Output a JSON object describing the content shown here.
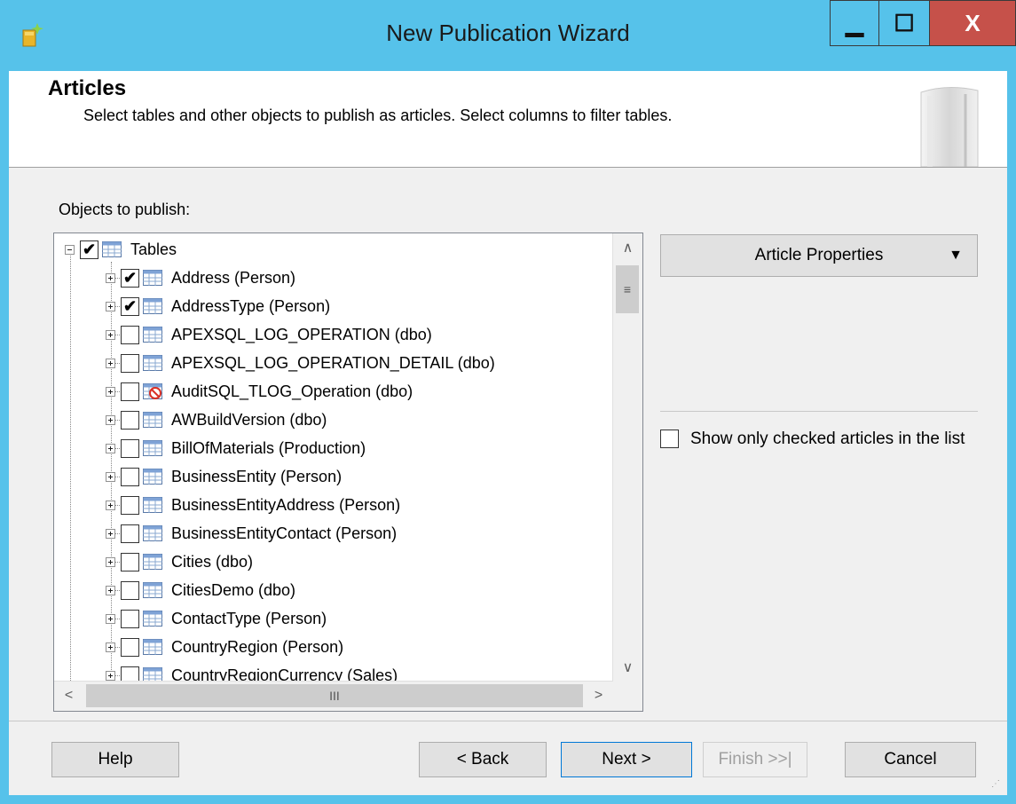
{
  "window": {
    "title": "New Publication Wizard",
    "controls": {
      "minimize": "▁",
      "maximize": "☐",
      "close": "X"
    }
  },
  "header": {
    "title": "Articles",
    "description": "Select tables and other objects to publish as articles. Select columns to filter tables."
  },
  "objects_label": "Objects to publish:",
  "tree": {
    "root": {
      "label": "Tables",
      "checked": true
    },
    "items": [
      {
        "label": "Address (Person)",
        "checked": true,
        "icon": "table-icon"
      },
      {
        "label": "AddressType (Person)",
        "checked": true,
        "icon": "table-icon"
      },
      {
        "label": "APEXSQL_LOG_OPERATION (dbo)",
        "checked": false,
        "icon": "table-icon"
      },
      {
        "label": "APEXSQL_LOG_OPERATION_DETAIL (dbo)",
        "checked": false,
        "icon": "table-icon"
      },
      {
        "label": "AuditSQL_TLOG_Operation (dbo)",
        "checked": false,
        "icon": "table-blocked-icon"
      },
      {
        "label": "AWBuildVersion (dbo)",
        "checked": false,
        "icon": "table-icon"
      },
      {
        "label": "BillOfMaterials (Production)",
        "checked": false,
        "icon": "table-icon"
      },
      {
        "label": "BusinessEntity (Person)",
        "checked": false,
        "icon": "table-icon"
      },
      {
        "label": "BusinessEntityAddress (Person)",
        "checked": false,
        "icon": "table-icon"
      },
      {
        "label": "BusinessEntityContact (Person)",
        "checked": false,
        "icon": "table-icon"
      },
      {
        "label": "Cities (dbo)",
        "checked": false,
        "icon": "table-icon"
      },
      {
        "label": "CitiesDemo (dbo)",
        "checked": false,
        "icon": "table-icon"
      },
      {
        "label": "ContactType (Person)",
        "checked": false,
        "icon": "table-icon"
      },
      {
        "label": "CountryRegion (Person)",
        "checked": false,
        "icon": "table-icon"
      },
      {
        "label": "CountryRegionCurrency (Sales)",
        "checked": false,
        "icon": "table-icon"
      }
    ]
  },
  "article_properties": {
    "label": "Article Properties",
    "arrow": "▼"
  },
  "show_only_checked": {
    "label": "Show only checked articles in the list",
    "checked": false
  },
  "buttons": {
    "help": "Help",
    "back": "< Back",
    "next": "Next >",
    "finish": "Finish >>|",
    "cancel": "Cancel"
  },
  "colors": {
    "titlebar": "#56c2ea",
    "close": "#c6514a",
    "accent": "#0078d7"
  }
}
